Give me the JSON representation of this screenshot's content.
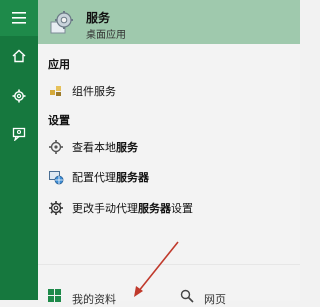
{
  "rail": {
    "items": [
      {
        "icon": "hamburger-icon"
      },
      {
        "icon": "home-icon"
      },
      {
        "icon": "gear-icon"
      },
      {
        "icon": "feedback-icon"
      }
    ]
  },
  "top_result": {
    "title": "服务",
    "subtitle": "桌面应用",
    "icon": "services-gear-icon"
  },
  "sections": {
    "apps": "应用",
    "settings": "设置"
  },
  "app_items": [
    {
      "label": "组件服务",
      "icon": "component-services-icon"
    }
  ],
  "settings_items": [
    {
      "prefix": "查看本地",
      "bold": "服务",
      "suffix": "",
      "icon": "view-services-icon"
    },
    {
      "prefix": "配置代理",
      "bold": "服务器",
      "suffix": "",
      "icon": "proxy-icon"
    },
    {
      "prefix": "更改手动代理",
      "bold": "服务器",
      "suffix": "设置",
      "icon": "settings-gear-icon"
    }
  ],
  "bottom": {
    "left_label": "我的资料",
    "right_label": "网页"
  },
  "colors": {
    "rail": "#16783e",
    "top_result_bg": "#9fc9ad",
    "arrow": "#c0392b"
  }
}
